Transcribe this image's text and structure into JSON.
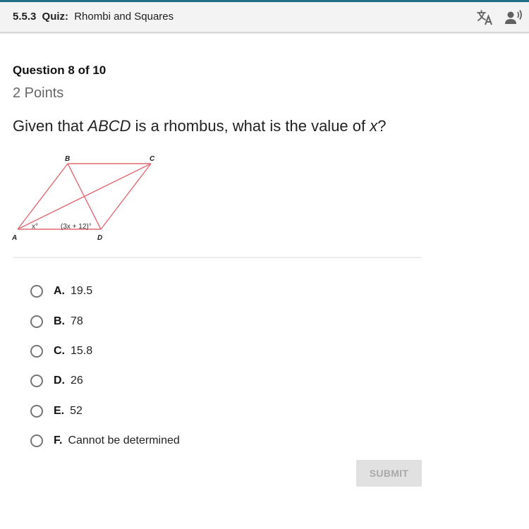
{
  "header": {
    "quiz_number": "5.5.3",
    "quiz_kind": "Quiz:",
    "quiz_name": "Rhombi and Squares",
    "icons": [
      "translate-icon",
      "text-to-speech-icon"
    ]
  },
  "question": {
    "number_label": "Question 8 of 10",
    "points": "2 Points",
    "prompt_before": "Given that ",
    "prompt_shape": "ABCD",
    "prompt_middle": " is a rhombus, what is the value of ",
    "prompt_variable": "x",
    "prompt_after": "?"
  },
  "diagram": {
    "stroke_color": "#e06b74",
    "vertex_labels": {
      "A": "A",
      "B": "B",
      "C": "C",
      "D": "D"
    },
    "angle_labels": {
      "at_A": "x°",
      "at_D": "(3x + 12)°"
    }
  },
  "choices": [
    {
      "letter": "A.",
      "text": "19.5"
    },
    {
      "letter": "B.",
      "text": "78"
    },
    {
      "letter": "C.",
      "text": "15.8"
    },
    {
      "letter": "D.",
      "text": "26"
    },
    {
      "letter": "E.",
      "text": "52"
    },
    {
      "letter": "F.",
      "text": "Cannot be determined"
    }
  ],
  "submit": {
    "label": "SUBMIT",
    "enabled": false
  }
}
